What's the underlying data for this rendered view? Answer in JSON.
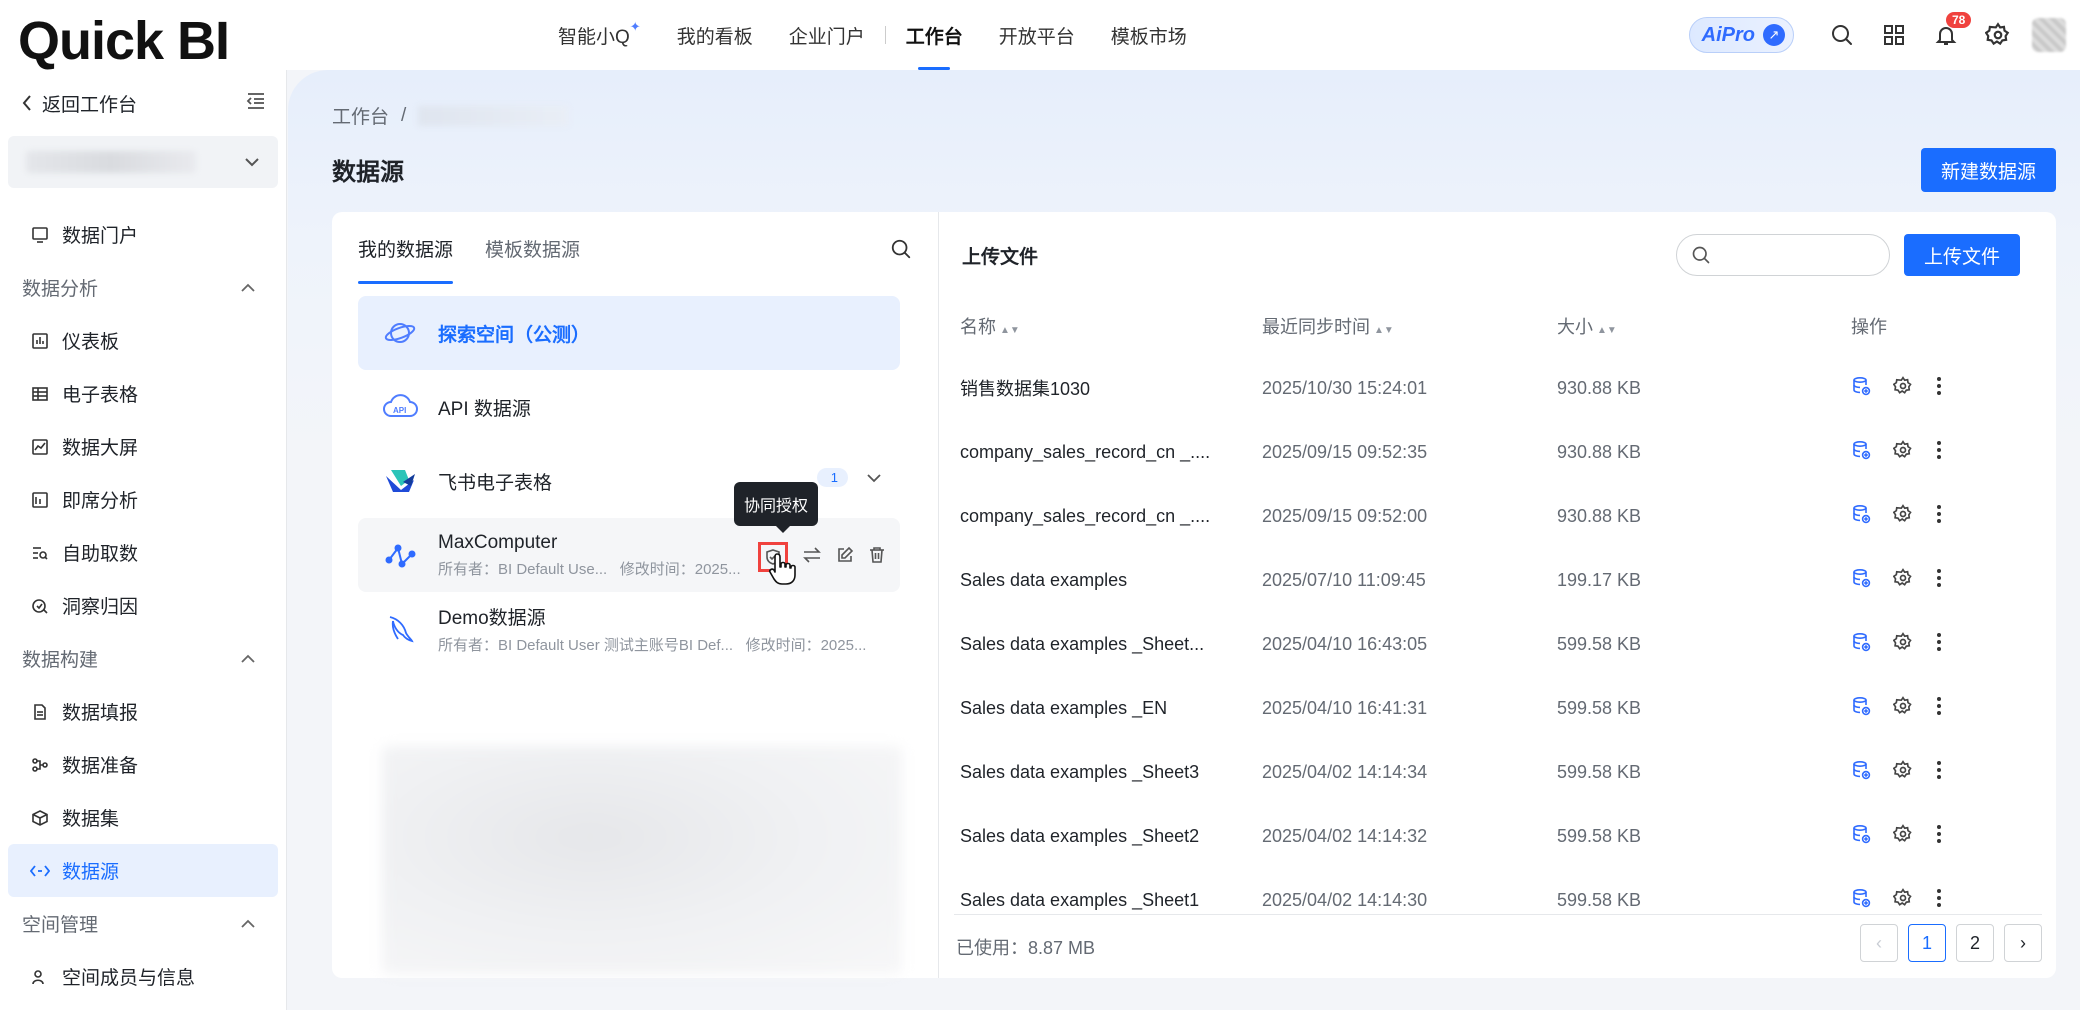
{
  "logo": "Quick BI",
  "topnav": {
    "items": [
      "智能小Q",
      "我的看板",
      "企业门户",
      "工作台",
      "开放平台",
      "模板市场"
    ],
    "active": "工作台"
  },
  "topright": {
    "aipro": "AiPro",
    "notifications": "78"
  },
  "sidebar": {
    "back": "返回工作台",
    "items": {
      "portal": "数据门户",
      "group_analysis": "数据分析",
      "dashboard": "仪表板",
      "spreadsheet": "电子表格",
      "bigscreen": "数据大屏",
      "adhoc": "即席分析",
      "selfservice": "自助取数",
      "insight": "洞察归因",
      "group_build": "数据构建",
      "fill": "数据填报",
      "prep": "数据准备",
      "dataset": "数据集",
      "datasource": "数据源",
      "group_space": "空间管理",
      "members": "空间成员与信息"
    }
  },
  "main": {
    "breadcrumb_root": "工作台",
    "breadcrumb_sep": "/",
    "title": "数据源",
    "new_button": "新建数据源"
  },
  "left_panel": {
    "tabs": [
      "我的数据源",
      "模板数据源"
    ],
    "list": [
      {
        "name": "探索空间（公测）"
      },
      {
        "name": "API 数据源"
      },
      {
        "name": "飞书电子表格",
        "count": "1"
      },
      {
        "name": "MaxComputer",
        "owner": "所有者：BI Default Use...",
        "modified": "修改时间：2025..."
      },
      {
        "name": "Demo数据源",
        "owner": "所有者：BI Default User 测试主账号BI Def...",
        "modified": "修改时间：2025..."
      }
    ],
    "tooltip": "协同授权"
  },
  "right_panel": {
    "title": "上传文件",
    "search_placeholder": "",
    "upload_button": "上传文件",
    "columns": [
      "名称",
      "最近同步时间",
      "大小",
      "操作"
    ],
    "rows": [
      {
        "name": "销售数据集1030",
        "time": "2025/10/30 15:24:01",
        "size": "930.88 KB"
      },
      {
        "name": "company_sales_record_cn _....",
        "time": "2025/09/15 09:52:35",
        "size": "930.88 KB"
      },
      {
        "name": "company_sales_record_cn _....",
        "time": "2025/09/15 09:52:00",
        "size": "930.88 KB"
      },
      {
        "name": "Sales data examples",
        "time": "2025/07/10 11:09:45",
        "size": "199.17 KB"
      },
      {
        "name": "Sales data examples _Sheet...",
        "time": "2025/04/10 16:43:05",
        "size": "599.58 KB"
      },
      {
        "name": "Sales data examples _EN",
        "time": "2025/04/10 16:41:31",
        "size": "599.58 KB"
      },
      {
        "name": "Sales data examples _Sheet3",
        "time": "2025/04/02 14:14:34",
        "size": "599.58 KB"
      },
      {
        "name": "Sales data examples _Sheet2",
        "time": "2025/04/02 14:14:32",
        "size": "599.58 KB"
      },
      {
        "name": "Sales data examples _Sheet1",
        "time": "2025/04/02 14:14:30",
        "size": "599.58 KB"
      }
    ],
    "used": "已使用：8.87 MB",
    "pages": [
      "1",
      "2"
    ],
    "prev": "‹",
    "next": "›"
  }
}
